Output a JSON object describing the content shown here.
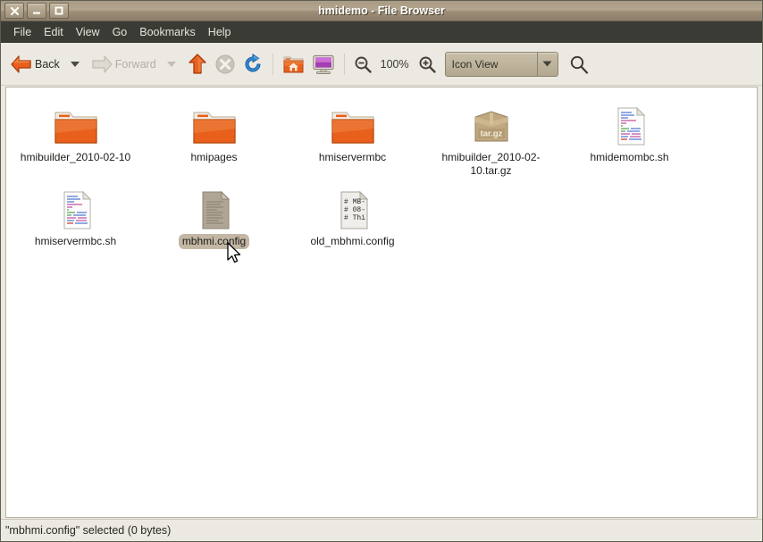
{
  "window": {
    "title": "hmidemo - File Browser",
    "buttons": [
      {
        "name": "close",
        "glyph": "X"
      },
      {
        "name": "minimize",
        "glyph": "—"
      },
      {
        "name": "maximize",
        "glyph": "□"
      }
    ]
  },
  "menubar": {
    "items": [
      "File",
      "Edit",
      "View",
      "Go",
      "Bookmarks",
      "Help"
    ]
  },
  "toolbar": {
    "back_label": "Back",
    "forward_label": "Forward",
    "up_icon": "up-arrow-icon",
    "stop_icon": "stop-icon",
    "reload_icon": "reload-icon",
    "home_icon": "home-folder-icon",
    "computer_icon": "computer-icon",
    "zoom_out_icon": "zoom-out-icon",
    "zoom_level": "100%",
    "zoom_in_icon": "zoom-in-icon",
    "view_mode": "Icon View",
    "search_icon": "search-icon"
  },
  "files": [
    {
      "name": "hmibuilder_2010-02-10",
      "type": "folder",
      "selected": false
    },
    {
      "name": "hmipages",
      "type": "folder",
      "selected": false
    },
    {
      "name": "hmiservermbc",
      "type": "folder",
      "selected": false
    },
    {
      "name": "hmibuilder_2010-02-10.tar.gz",
      "type": "archive",
      "badge": "tar.gz",
      "selected": false
    },
    {
      "name": "hmidemombc.sh",
      "type": "script",
      "selected": false
    },
    {
      "name": "hmiservermbc.sh",
      "type": "script",
      "selected": false
    },
    {
      "name": "mbhmi.config",
      "type": "config",
      "selected": true
    },
    {
      "name": "old_mbhmi.config",
      "type": "text",
      "preview": [
        "# MB-",
        "# 08-",
        "# Thi"
      ],
      "selected": false
    }
  ],
  "statusbar": {
    "text": "\"mbhmi.config\" selected (0 bytes)"
  },
  "colors": {
    "accent_orange": "#e8601c",
    "titlebar": "#a99a84",
    "menubar": "#3b3b36",
    "selection": "#c3b7a4"
  }
}
